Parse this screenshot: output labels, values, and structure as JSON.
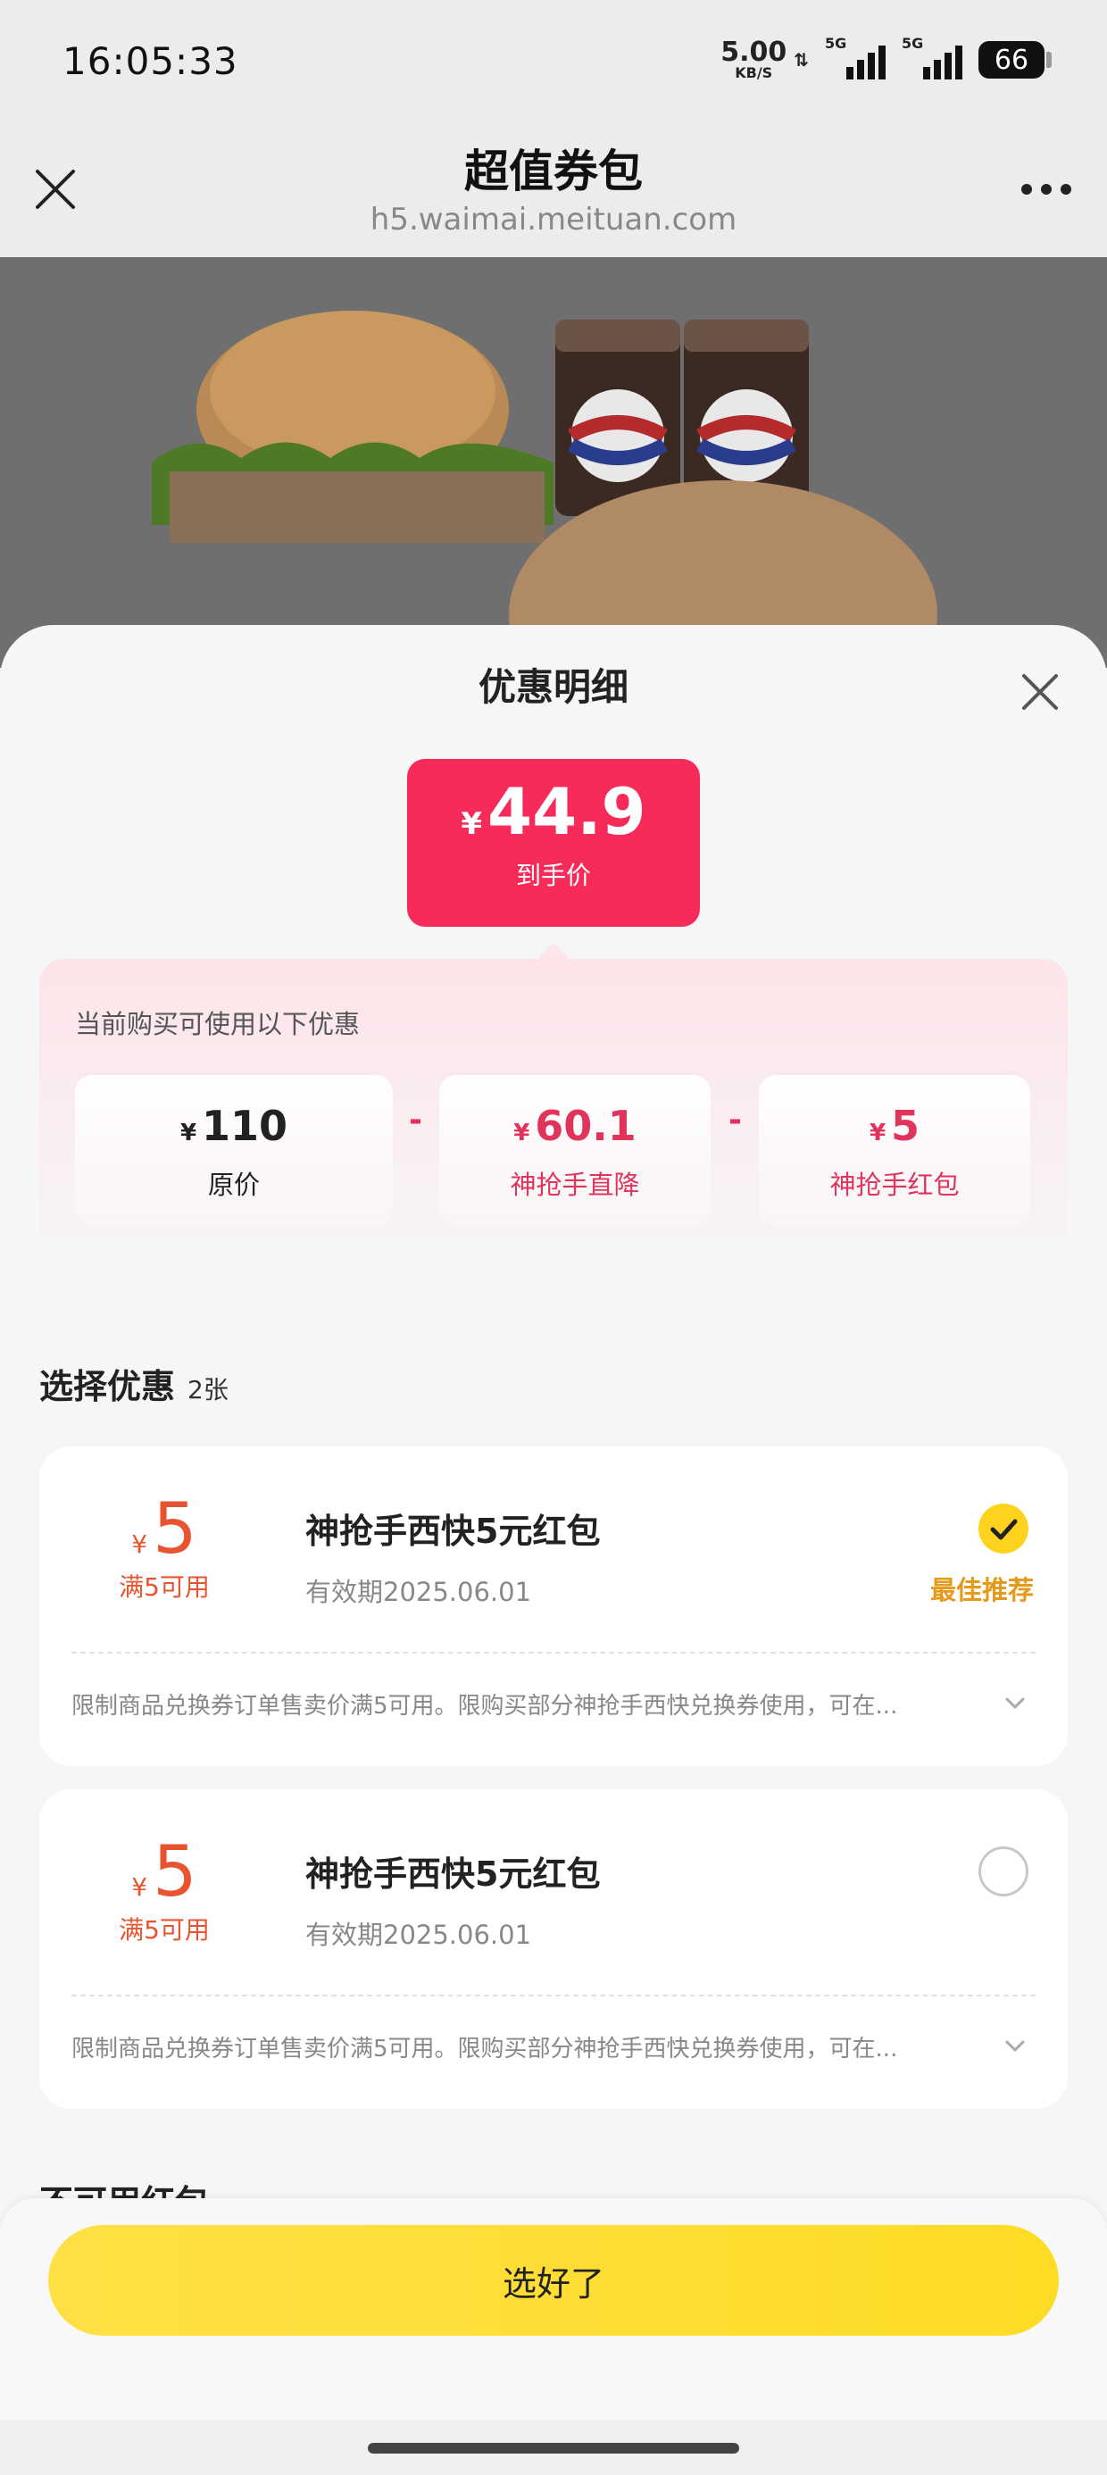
{
  "status_bar": {
    "time": "16:05:33",
    "speed_value": "5.00",
    "speed_unit": "KB/S",
    "signal1_label": "5G",
    "signal2_label": "5G",
    "battery": "66"
  },
  "header": {
    "title": "超值券包",
    "url": "h5.waimai.meituan.com"
  },
  "sheet": {
    "title": "优惠明细",
    "final_price": {
      "currency": "¥",
      "value": "44.9",
      "label": "到手价"
    },
    "note": "当前购买可使用以下优惠",
    "breakdown": [
      {
        "currency": "¥",
        "value": "110",
        "label": "原价",
        "color": "#222222"
      },
      {
        "currency": "¥",
        "value": "60.1",
        "label": "神抢手直降",
        "color": "#e0345c"
      },
      {
        "currency": "¥",
        "value": "5",
        "label": "神抢手红包",
        "color": "#e0345c"
      }
    ],
    "operators": [
      "-",
      "-"
    ],
    "select_section": {
      "title": "选择优惠",
      "count": "2张"
    },
    "coupons": [
      {
        "currency": "¥",
        "value": "5",
        "condition": "满5可用",
        "name": "神抢手西快5元红包",
        "expiry": "有效期2025.06.01",
        "selected": true,
        "badge": "最佳推荐",
        "description": "限制商品兑换券订单售卖价满5可用。限购买部分神抢手西快兑换券使用，可在..."
      },
      {
        "currency": "¥",
        "value": "5",
        "condition": "满5可用",
        "name": "神抢手西快5元红包",
        "expiry": "有效期2025.06.01",
        "selected": false,
        "badge": "",
        "description": "限制商品兑换券订单售卖价满5可用。限购买部分神抢手西快兑换券使用，可在..."
      }
    ],
    "unavailable_section": {
      "title": "不可用红包"
    },
    "confirm_label": "选好了"
  },
  "colors": {
    "accent_pink": "#f72b5a",
    "coupon_orange": "#e8542f",
    "button_yellow": "#fddc25",
    "badge_orange": "#e59a1a"
  },
  "icons": [
    "close-icon",
    "more-icon",
    "checkmark-icon",
    "chevron-down-icon",
    "pepsi-cup-image",
    "burger-image"
  ]
}
